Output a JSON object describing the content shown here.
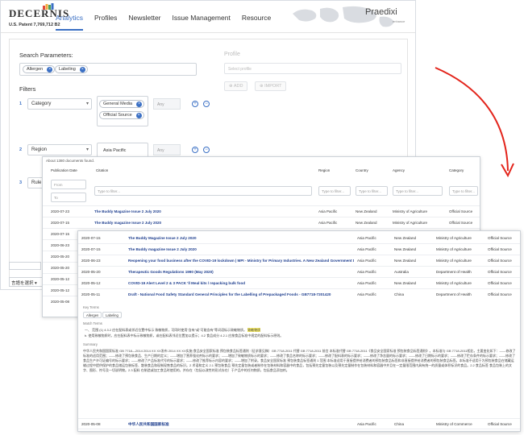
{
  "app": {
    "logo": "DECERNIS",
    "patent": "U.S. Patent 7,769,712 B2",
    "brand2": "Praedixi",
    "brand2_sub": "enhance",
    "nav": [
      "Analytics",
      "Profiles",
      "Newsletter",
      "Issue Management",
      "Resource"
    ],
    "accent": "#3a6fc4"
  },
  "search": {
    "label": "Search Parameters:",
    "chips": [
      "Allergen",
      "Labeling"
    ],
    "profile_label": "Profile",
    "profile_placeholder": "Select profile",
    "add_label": "ADD",
    "import_label": "IMPORT"
  },
  "filters": {
    "label": "Filters",
    "rows": [
      {
        "num": "1",
        "field": "Category",
        "values": [
          "General Media",
          "Official Source"
        ],
        "any": "Any"
      },
      {
        "num": "2",
        "field": "Region",
        "values": [
          "Asia Pacific"
        ],
        "any": "Any"
      },
      {
        "num": "3",
        "field": "Rule",
        "values": [],
        "any": ""
      }
    ]
  },
  "lang_select": "言語を選択",
  "results": {
    "summary": "About 1380 documents found.",
    "columns": [
      "Publication Date",
      "Citation",
      "Region",
      "Country",
      "Agency",
      "Category"
    ],
    "from_placeholder": "From",
    "to_placeholder": "To",
    "filter_placeholder": "Type to filter...",
    "rows": [
      {
        "date": "2020-07-23",
        "citation": "The Buddy Magazine Issue 2 July 2020",
        "region": "Asia Pacific",
        "country": "New Zealand",
        "agency": "Ministry of Agriculture",
        "category": "Official Source"
      },
      {
        "date": "2020-07-15",
        "citation": "The Buddy magazine Issue 2 July 2020",
        "region": "Asia Pacific",
        "country": "New Zealand",
        "agency": "Ministry of Agriculture",
        "category": "Official Source"
      },
      {
        "date": "2020-07-15",
        "citation": "",
        "region": "",
        "country": "",
        "agency": "",
        "category": ""
      },
      {
        "date": "2020-06-23",
        "citation": "",
        "region": "",
        "country": "",
        "agency": "",
        "category": ""
      },
      {
        "date": "2020-05-20",
        "citation": "",
        "region": "",
        "country": "",
        "agency": "",
        "category": ""
      },
      {
        "date": "2020-05-20",
        "citation": "",
        "region": "",
        "country": "",
        "agency": "",
        "category": ""
      },
      {
        "date": "2020-05-12",
        "citation": "",
        "region": "",
        "country": "",
        "agency": "",
        "category": ""
      },
      {
        "date": "2020-05-12",
        "citation": "",
        "region": "",
        "country": "",
        "agency": "",
        "category": ""
      },
      {
        "date": "2020-05-08",
        "citation": "",
        "region": "",
        "country": "",
        "agency": "",
        "category": ""
      }
    ]
  },
  "detail": {
    "rows": [
      {
        "date": "2020-07-15",
        "citation": "The Buddy Magazine Issue 2 July 2020",
        "region": "Asia Pacific",
        "country": "New Zealand",
        "agency": "Ministry of Agriculture",
        "category": "Official Source"
      },
      {
        "date": "2020-07-15",
        "citation": "The Buddy magazine Issue 2 July 2020",
        "region": "Asia Pacific",
        "country": "New Zealand",
        "agency": "Ministry of Agriculture",
        "category": "Official Source"
      },
      {
        "date": "2020-06-23",
        "citation": "Reopening your food business after the COVID-19 lockdown | MPI - Ministry for Primary Industries. A New Zealand Government Departmen...",
        "region": "Asia Pacific",
        "country": "New Zealand",
        "agency": "Ministry of Agriculture",
        "category": "Official Source"
      },
      {
        "date": "2020-05-20",
        "citation": "Therapeutic Goods Regulations 1990 (May 2020)",
        "region": "Asia Pacific",
        "country": "Australia",
        "agency": "Department of Health",
        "category": "Official Source"
      },
      {
        "date": "2020-05-12",
        "citation": "COVID-19 Alert Level 2 & 3 PACK 'll Meal kits / repacking bulk food",
        "region": "Asia Pacific",
        "country": "New Zealand",
        "agency": "Ministry of Agriculture",
        "category": "Official Source"
      },
      {
        "date": "2020-05-11",
        "citation": "Draft - National Food Safety Standard General Principles for the Labelling of Prepackaged Foods - GB7718-7201420",
        "region": "Asia Pacific",
        "country": "China",
        "agency": "Department of Health",
        "category": "Official Source"
      }
    ],
    "key_terms_label": "Key Terms",
    "tags": [
      "Allergen",
      "Labeling"
    ],
    "match_terms_label": "Match Terms",
    "match_line_1": "一、 范围 (1) 4.3.2 应在配料表或邻近位置中标示 致敏物质，可同时使用\"含有\"或\"可能含有\"等词语标示致敏物质。",
    "match_highlight": "致敏物质",
    "match_line_2": "b. 使用致敏物质时，应在配料表中标示致敏物质，或在配料表邻近位置加以提示；4.2 食品成分 4.2.1 应按食品标准中规定的配料标示原则。",
    "summary_label": "Summary",
    "summary_text": "中华人民共和国国家标准 GB 7718—2014 2014 XX XX发布 2014 XX XX实施 食品安全国家标准 预包装食品标签通则（征求意见稿）GB 7718-2011 代替 GB 7718-2011 前言 本标准代替 GB 7718-2011《食品安全国家标准 预包装食品标签通则》。本标准与 GB 7718-2011相比，主要变化如下：——修改了标准的适用范围；——修改了预包装食品、生产日期的定义；——增加了营养强化剂标示的要求；——增加了致敏物质标示的要求；——修改了食品名称的标示要求；——修改了配料表的标示要求；——修改了净含量的标示要求；——修改了日期标示的要求；——修改了贮存条件的标示要求；——修改了食品生产许可证编号的标示要求；——修改了产品标准代号的标示要求；——修改了推荐标示内容的要求；——增加了附录。食品安全国家标准 预包装食品标签通则 1 范围 本标准适用于直接提供给消费者的预包装食品标签和非直接提供给消费者的预包装食品标签。本标准不适用于为预包装食品在储藏运输过程中提供保护的食品储运包装标签、散装食品和现制现售食品的标识。2 术语和定义 2.1 预包装食品 预先定量包装或者制作在包装材料和容器中的食品，包括预先定量包装以及预先定量制作在包装材料和容器中并且在一定量限范围内具有统一的质量或体积标识的食品。2.2 食品标签 食品包装上的文字、图形、符号及一切说明物。2.3 配料 在制造或加工食品时使用的，并存在（包括以改性的形式存在）于产品中的任何物质，包括食品添加剂。",
    "last_row": {
      "date": "2020-05-08",
      "citation": "中华人民共和国国家标准",
      "region": "Asia Pacific",
      "country": "China",
      "agency": "Ministry of Commerce",
      "category": "Official Source"
    }
  }
}
